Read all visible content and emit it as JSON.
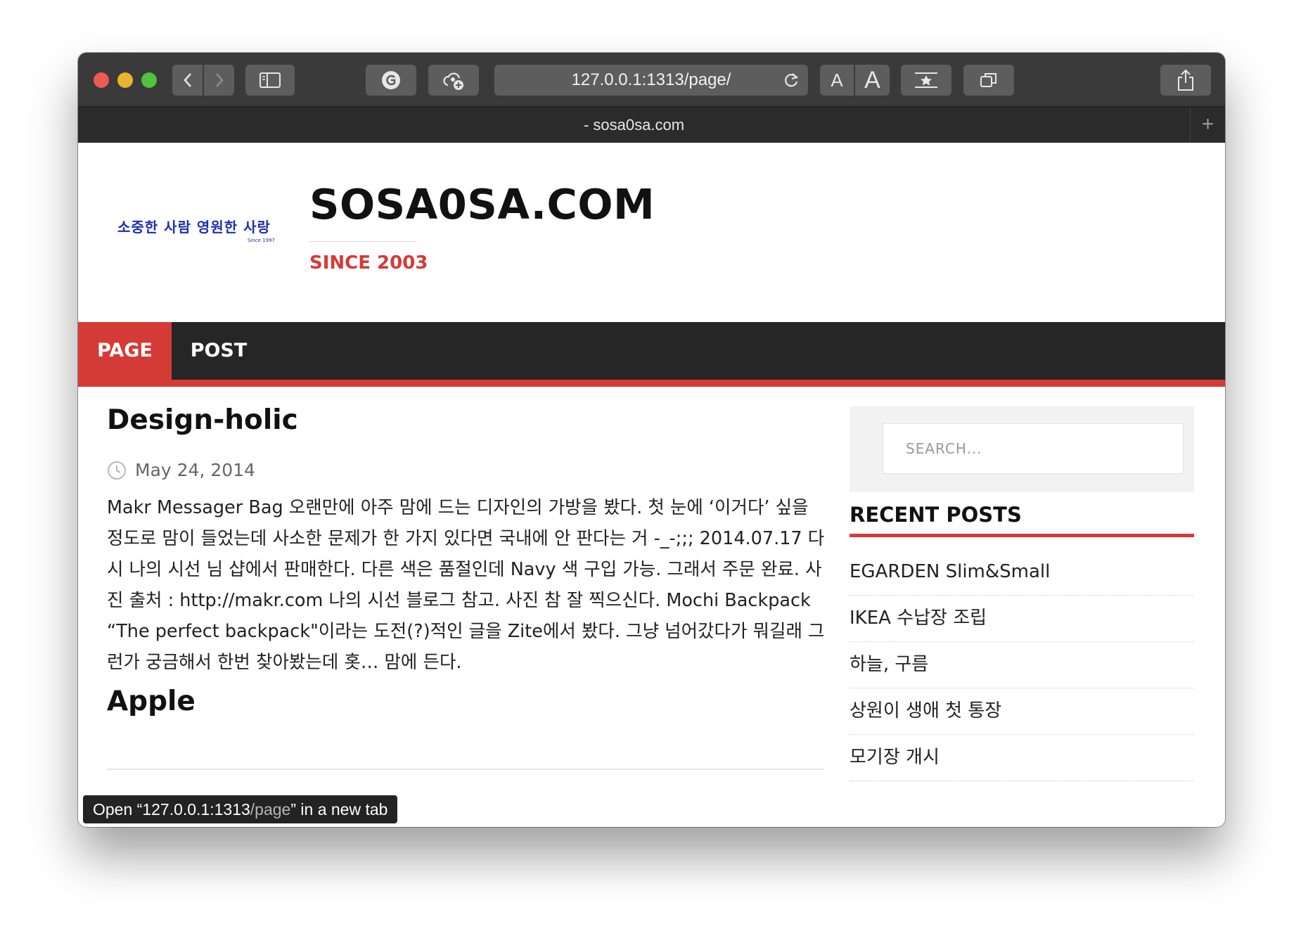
{
  "browser": {
    "url": "127.0.0.1:1313/page/",
    "tab_title": "- sosa0sa.com",
    "text_size_small": "A",
    "text_size_large": "A",
    "new_tab": "+"
  },
  "site": {
    "logo_text": "소중한 사람 영원한 사랑",
    "logo_since": "Since 1997",
    "title": "SOSA0SA.COM",
    "description": "SINCE 2003"
  },
  "nav": {
    "items": [
      {
        "label": "PAGE",
        "active": true
      },
      {
        "label": "POST",
        "active": false
      }
    ]
  },
  "posts": [
    {
      "title": "Design-holic",
      "date": "May 24, 2014",
      "excerpt": "Makr Messager Bag 오랜만에 아주 맘에 드는 디자인의 가방을 봤다. 첫 눈에 ‘이거다’ 싶을 정도로 맘이 들었는데 사소한 문제가 한 가지 있다면 국내에 안 판다는 거 -_-;;; 2014.07.17 다시 나의 시선 님 샵에서 판매한다. 다른 색은 품절인데 Navy 색 구입 가능. 그래서 주문 완료. 사진 출처 : http://makr.com 나의 시선 블로그 참고. 사진 참 잘 찍으신다. Mochi Backpack “The perfect backpack\"이라는 도전(?)적인 글을 Zite에서 봤다. 그냥 넘어갔다가 뭐길래 그런가 궁금해서 한번 찾아봤는데 홋… 맘에 든다."
    },
    {
      "title": "Apple"
    }
  ],
  "sidebar": {
    "search_placeholder": "SEARCH...",
    "recent_title": "RECENT POSTS",
    "recent_posts": [
      "EGARDEN Slim&Small",
      "IKEA 수납장 조립",
      "하늘, 구름",
      "상원이 생애 첫 통장",
      "모기장 개시"
    ]
  },
  "tooltip": {
    "prefix": "Open “127.0.0.1:1313",
    "dim": "/page",
    "suffix": "” in a new tab"
  },
  "colors": {
    "accent": "#d53b36",
    "nav_bg": "#262626",
    "logo": "#1c2fb5"
  }
}
